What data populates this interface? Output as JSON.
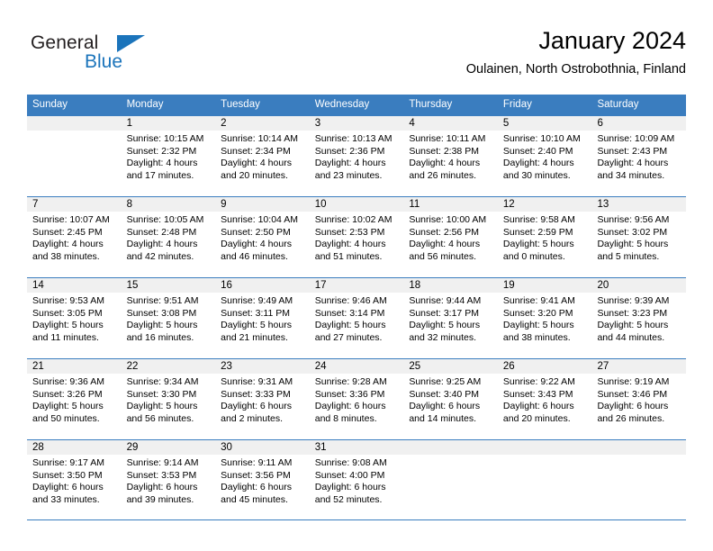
{
  "brand": {
    "name_part1": "General",
    "name_part2": "Blue",
    "logo_icon": "triangle-flag-icon"
  },
  "header": {
    "title": "January 2024",
    "subtitle": "Oulainen, North Ostrobothnia, Finland"
  },
  "colors": {
    "header_blue": "#3a7dbf",
    "brand_blue": "#1b74bb",
    "daynum_band": "#f0f0f0",
    "text": "#000000"
  },
  "calendar": {
    "weekday_headers": [
      "Sunday",
      "Monday",
      "Tuesday",
      "Wednesday",
      "Thursday",
      "Friday",
      "Saturday"
    ],
    "weeks": [
      [
        {
          "day": "",
          "lines": []
        },
        {
          "day": "1",
          "lines": [
            "Sunrise: 10:15 AM",
            "Sunset: 2:32 PM",
            "Daylight: 4 hours",
            "and 17 minutes."
          ]
        },
        {
          "day": "2",
          "lines": [
            "Sunrise: 10:14 AM",
            "Sunset: 2:34 PM",
            "Daylight: 4 hours",
            "and 20 minutes."
          ]
        },
        {
          "day": "3",
          "lines": [
            "Sunrise: 10:13 AM",
            "Sunset: 2:36 PM",
            "Daylight: 4 hours",
            "and 23 minutes."
          ]
        },
        {
          "day": "4",
          "lines": [
            "Sunrise: 10:11 AM",
            "Sunset: 2:38 PM",
            "Daylight: 4 hours",
            "and 26 minutes."
          ]
        },
        {
          "day": "5",
          "lines": [
            "Sunrise: 10:10 AM",
            "Sunset: 2:40 PM",
            "Daylight: 4 hours",
            "and 30 minutes."
          ]
        },
        {
          "day": "6",
          "lines": [
            "Sunrise: 10:09 AM",
            "Sunset: 2:43 PM",
            "Daylight: 4 hours",
            "and 34 minutes."
          ]
        }
      ],
      [
        {
          "day": "7",
          "lines": [
            "Sunrise: 10:07 AM",
            "Sunset: 2:45 PM",
            "Daylight: 4 hours",
            "and 38 minutes."
          ]
        },
        {
          "day": "8",
          "lines": [
            "Sunrise: 10:05 AM",
            "Sunset: 2:48 PM",
            "Daylight: 4 hours",
            "and 42 minutes."
          ]
        },
        {
          "day": "9",
          "lines": [
            "Sunrise: 10:04 AM",
            "Sunset: 2:50 PM",
            "Daylight: 4 hours",
            "and 46 minutes."
          ]
        },
        {
          "day": "10",
          "lines": [
            "Sunrise: 10:02 AM",
            "Sunset: 2:53 PM",
            "Daylight: 4 hours",
            "and 51 minutes."
          ]
        },
        {
          "day": "11",
          "lines": [
            "Sunrise: 10:00 AM",
            "Sunset: 2:56 PM",
            "Daylight: 4 hours",
            "and 56 minutes."
          ]
        },
        {
          "day": "12",
          "lines": [
            "Sunrise: 9:58 AM",
            "Sunset: 2:59 PM",
            "Daylight: 5 hours",
            "and 0 minutes."
          ]
        },
        {
          "day": "13",
          "lines": [
            "Sunrise: 9:56 AM",
            "Sunset: 3:02 PM",
            "Daylight: 5 hours",
            "and 5 minutes."
          ]
        }
      ],
      [
        {
          "day": "14",
          "lines": [
            "Sunrise: 9:53 AM",
            "Sunset: 3:05 PM",
            "Daylight: 5 hours",
            "and 11 minutes."
          ]
        },
        {
          "day": "15",
          "lines": [
            "Sunrise: 9:51 AM",
            "Sunset: 3:08 PM",
            "Daylight: 5 hours",
            "and 16 minutes."
          ]
        },
        {
          "day": "16",
          "lines": [
            "Sunrise: 9:49 AM",
            "Sunset: 3:11 PM",
            "Daylight: 5 hours",
            "and 21 minutes."
          ]
        },
        {
          "day": "17",
          "lines": [
            "Sunrise: 9:46 AM",
            "Sunset: 3:14 PM",
            "Daylight: 5 hours",
            "and 27 minutes."
          ]
        },
        {
          "day": "18",
          "lines": [
            "Sunrise: 9:44 AM",
            "Sunset: 3:17 PM",
            "Daylight: 5 hours",
            "and 32 minutes."
          ]
        },
        {
          "day": "19",
          "lines": [
            "Sunrise: 9:41 AM",
            "Sunset: 3:20 PM",
            "Daylight: 5 hours",
            "and 38 minutes."
          ]
        },
        {
          "day": "20",
          "lines": [
            "Sunrise: 9:39 AM",
            "Sunset: 3:23 PM",
            "Daylight: 5 hours",
            "and 44 minutes."
          ]
        }
      ],
      [
        {
          "day": "21",
          "lines": [
            "Sunrise: 9:36 AM",
            "Sunset: 3:26 PM",
            "Daylight: 5 hours",
            "and 50 minutes."
          ]
        },
        {
          "day": "22",
          "lines": [
            "Sunrise: 9:34 AM",
            "Sunset: 3:30 PM",
            "Daylight: 5 hours",
            "and 56 minutes."
          ]
        },
        {
          "day": "23",
          "lines": [
            "Sunrise: 9:31 AM",
            "Sunset: 3:33 PM",
            "Daylight: 6 hours",
            "and 2 minutes."
          ]
        },
        {
          "day": "24",
          "lines": [
            "Sunrise: 9:28 AM",
            "Sunset: 3:36 PM",
            "Daylight: 6 hours",
            "and 8 minutes."
          ]
        },
        {
          "day": "25",
          "lines": [
            "Sunrise: 9:25 AM",
            "Sunset: 3:40 PM",
            "Daylight: 6 hours",
            "and 14 minutes."
          ]
        },
        {
          "day": "26",
          "lines": [
            "Sunrise: 9:22 AM",
            "Sunset: 3:43 PM",
            "Daylight: 6 hours",
            "and 20 minutes."
          ]
        },
        {
          "day": "27",
          "lines": [
            "Sunrise: 9:19 AM",
            "Sunset: 3:46 PM",
            "Daylight: 6 hours",
            "and 26 minutes."
          ]
        }
      ],
      [
        {
          "day": "28",
          "lines": [
            "Sunrise: 9:17 AM",
            "Sunset: 3:50 PM",
            "Daylight: 6 hours",
            "and 33 minutes."
          ]
        },
        {
          "day": "29",
          "lines": [
            "Sunrise: 9:14 AM",
            "Sunset: 3:53 PM",
            "Daylight: 6 hours",
            "and 39 minutes."
          ]
        },
        {
          "day": "30",
          "lines": [
            "Sunrise: 9:11 AM",
            "Sunset: 3:56 PM",
            "Daylight: 6 hours",
            "and 45 minutes."
          ]
        },
        {
          "day": "31",
          "lines": [
            "Sunrise: 9:08 AM",
            "Sunset: 4:00 PM",
            "Daylight: 6 hours",
            "and 52 minutes."
          ]
        },
        {
          "day": "",
          "lines": []
        },
        {
          "day": "",
          "lines": []
        },
        {
          "day": "",
          "lines": []
        }
      ]
    ]
  }
}
